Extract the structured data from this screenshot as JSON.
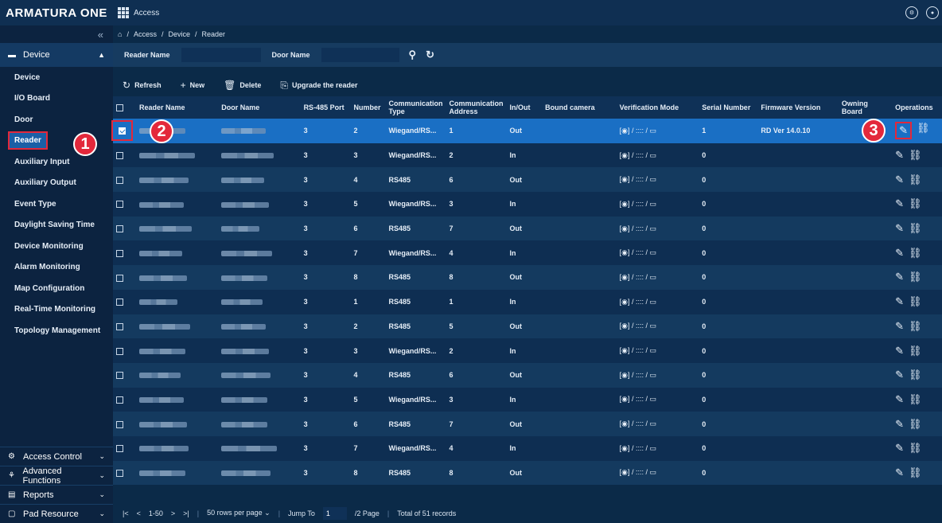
{
  "app": {
    "logo": "ARMATURA ONE",
    "module": "Access"
  },
  "sidebar": {
    "section": "Device",
    "items": [
      "Device",
      "I/O Board",
      "Door",
      "Reader",
      "Auxiliary Input",
      "Auxiliary Output",
      "Event Type",
      "Daylight Saving Time",
      "Device Monitoring",
      "Alarm Monitoring",
      "Map Configuration",
      "Real-Time Monitoring",
      "Topology Management"
    ],
    "bottom": [
      "Access Control",
      "Advanced Functions",
      "Reports",
      "Pad Resource"
    ]
  },
  "breadcrumb": [
    "Access",
    "Device",
    "Reader"
  ],
  "filter": {
    "reader_name_label": "Reader Name",
    "door_name_label": "Door Name"
  },
  "toolbar": {
    "refresh": "Refresh",
    "new": "New",
    "delete": "Delete",
    "upgrade": "Upgrade the reader"
  },
  "columns": [
    "Reader Name",
    "Door Name",
    "RS-485 Port",
    "Number",
    "Communication Type",
    "Communication Address",
    "In/Out",
    "Bound camera",
    "Verification Mode",
    "Serial Number",
    "Firmware Version",
    "Owning Board",
    "Operations"
  ],
  "rows": [
    {
      "port": "3",
      "number": "2",
      "type": "Wiegand/RS...",
      "addr": "1",
      "io": "Out",
      "serial": "1",
      "firmware": "RD Ver 14.0.10"
    },
    {
      "port": "3",
      "number": "3",
      "type": "Wiegand/RS...",
      "addr": "2",
      "io": "In",
      "serial": "0",
      "firmware": ""
    },
    {
      "port": "3",
      "number": "4",
      "type": "RS485",
      "addr": "6",
      "io": "Out",
      "serial": "0",
      "firmware": ""
    },
    {
      "port": "3",
      "number": "5",
      "type": "Wiegand/RS...",
      "addr": "3",
      "io": "In",
      "serial": "0",
      "firmware": ""
    },
    {
      "port": "3",
      "number": "6",
      "type": "RS485",
      "addr": "7",
      "io": "Out",
      "serial": "0",
      "firmware": ""
    },
    {
      "port": "3",
      "number": "7",
      "type": "Wiegand/RS...",
      "addr": "4",
      "io": "In",
      "serial": "0",
      "firmware": ""
    },
    {
      "port": "3",
      "number": "8",
      "type": "RS485",
      "addr": "8",
      "io": "Out",
      "serial": "0",
      "firmware": ""
    },
    {
      "port": "3",
      "number": "1",
      "type": "RS485",
      "addr": "1",
      "io": "In",
      "serial": "0",
      "firmware": ""
    },
    {
      "port": "3",
      "number": "2",
      "type": "RS485",
      "addr": "5",
      "io": "Out",
      "serial": "0",
      "firmware": ""
    },
    {
      "port": "3",
      "number": "3",
      "type": "Wiegand/RS...",
      "addr": "2",
      "io": "In",
      "serial": "0",
      "firmware": ""
    },
    {
      "port": "3",
      "number": "4",
      "type": "RS485",
      "addr": "6",
      "io": "Out",
      "serial": "0",
      "firmware": ""
    },
    {
      "port": "3",
      "number": "5",
      "type": "Wiegand/RS...",
      "addr": "3",
      "io": "In",
      "serial": "0",
      "firmware": ""
    },
    {
      "port": "3",
      "number": "6",
      "type": "RS485",
      "addr": "7",
      "io": "Out",
      "serial": "0",
      "firmware": ""
    },
    {
      "port": "3",
      "number": "7",
      "type": "Wiegand/RS...",
      "addr": "4",
      "io": "In",
      "serial": "0",
      "firmware": ""
    },
    {
      "port": "3",
      "number": "8",
      "type": "RS485",
      "addr": "8",
      "io": "Out",
      "serial": "0",
      "firmware": ""
    }
  ],
  "verification_mode": "[◉] / :::: / ▭",
  "pagination": {
    "range": "1-50",
    "rows_per_page": "50 rows per page",
    "jump_label": "Jump To",
    "jump_value": "1",
    "pages": "/2 Page",
    "total": "Total of 51 records"
  },
  "badges": [
    "1",
    "2",
    "3"
  ]
}
